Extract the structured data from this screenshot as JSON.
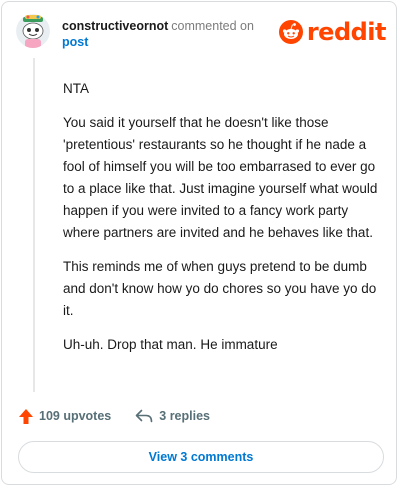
{
  "header": {
    "username": "constructiveornot",
    "commented_on": "commented on",
    "post_link": "post",
    "brand_name": "reddit"
  },
  "comment": {
    "paragraphs": [
      "NTA",
      "You said it yourself that he doesn't like those 'pretentious' restaurants so he thought if he nade a fool of himself you will be too embarrased to ever go to a place like that. Just imagine yourself what would happen if you were invited to a fancy work party where partners are invited and he behaves like that.",
      "This reminds me of when guys pretend to be dumb and don't know how yo do chores so you have yo do it.",
      "Uh-uh. Drop that man. He immature"
    ]
  },
  "footer": {
    "upvotes": "109 upvotes",
    "replies": "3 replies",
    "view_comments": "View 3 comments"
  },
  "colors": {
    "brand": "#ff4500",
    "link": "#0079d3",
    "muted": "#7c7c7c",
    "border": "#d9dcdf"
  },
  "icons": {
    "upvote": "upvote-arrow-icon",
    "reply": "reply-arrow-icon",
    "brand": "reddit-snoo-icon",
    "avatar": "snoo-avatar"
  }
}
